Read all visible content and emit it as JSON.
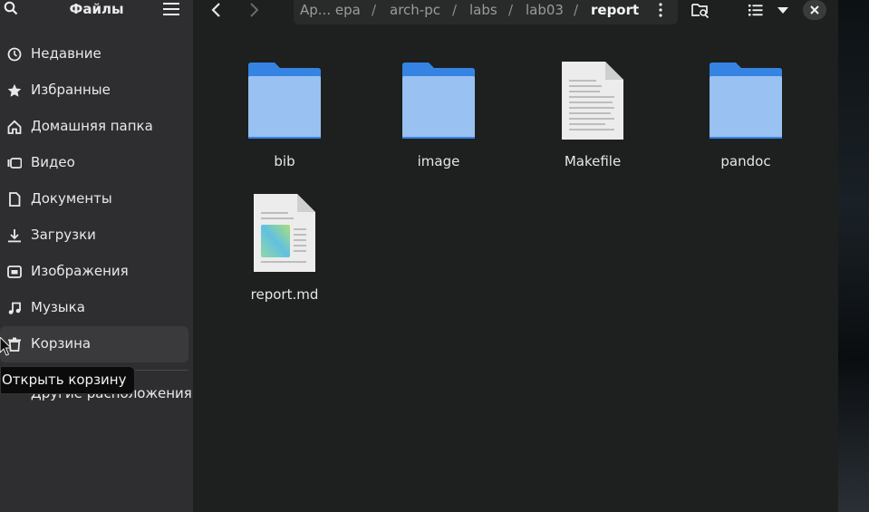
{
  "sidebar": {
    "title": "Файлы",
    "items": [
      {
        "label": "Недавние",
        "icon": "recent-icon"
      },
      {
        "label": "Избранные",
        "icon": "star-icon"
      },
      {
        "label": "Домашняя папка",
        "icon": "home-icon"
      },
      {
        "label": "Видео",
        "icon": "video-icon"
      },
      {
        "label": "Документы",
        "icon": "document-icon"
      },
      {
        "label": "Загрузки",
        "icon": "download-icon"
      },
      {
        "label": "Изображения",
        "icon": "image-icon"
      },
      {
        "label": "Музыка",
        "icon": "music-icon"
      },
      {
        "label": "Корзина",
        "icon": "trash-icon"
      }
    ],
    "other_locations": "Другие расположения",
    "tooltip": "Открыть корзину"
  },
  "path": {
    "segments": [
      "Ар... ера",
      "arch-pc",
      "labs",
      "lab03",
      "report"
    ],
    "separator": "/"
  },
  "files": [
    {
      "name": "bib",
      "type": "folder"
    },
    {
      "name": "image",
      "type": "folder"
    },
    {
      "name": "Makefile",
      "type": "text"
    },
    {
      "name": "pandoc",
      "type": "folder"
    },
    {
      "name": "report.md",
      "type": "markdown"
    }
  ],
  "colors": {
    "folder_front": "#99c1f1",
    "folder_back": "#3584e4",
    "sidebar_bg": "#2e2e30",
    "content_bg": "#1d201e"
  }
}
